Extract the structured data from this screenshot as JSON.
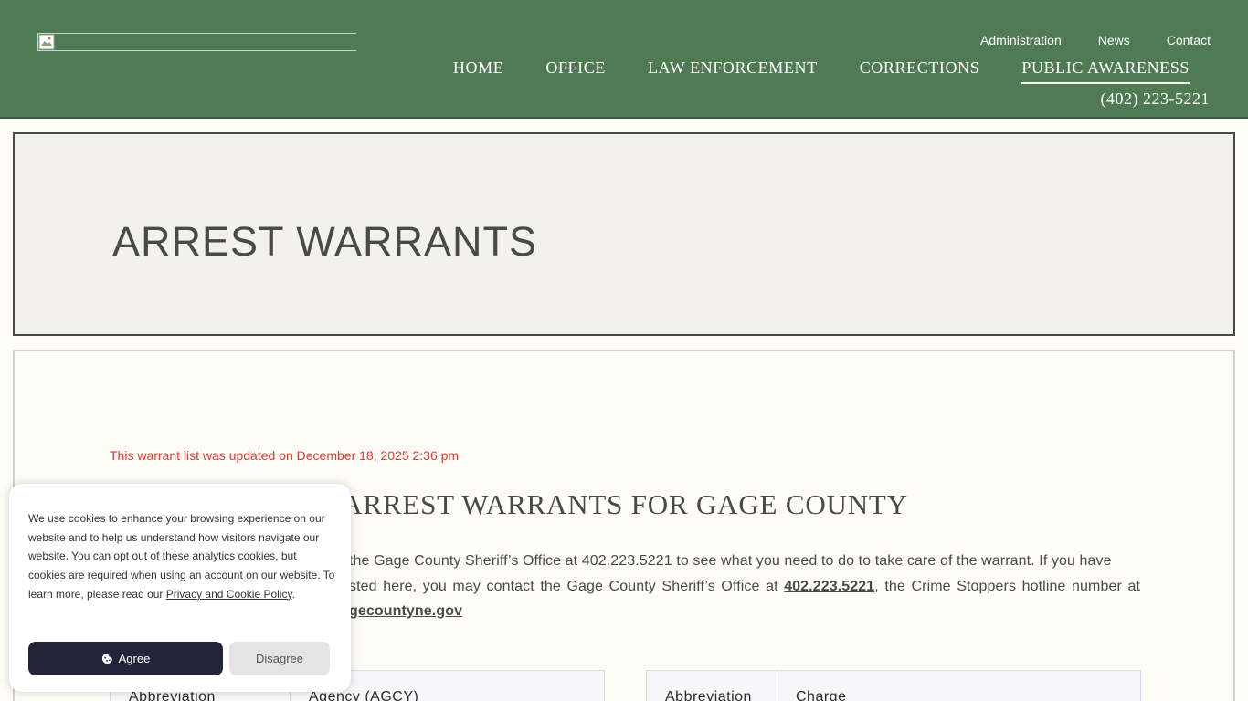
{
  "header": {
    "logo_alt": "",
    "util_nav": [
      "Administration",
      "News",
      "Contact"
    ],
    "main_nav": [
      "HOME",
      "OFFICE",
      "LAW ENFORCEMENT",
      "CORRECTIONS",
      "PUBLIC AWARENESS"
    ],
    "active_nav": "PUBLIC AWARENESS",
    "phone": "(402) 223-5221",
    "bg_color": "#507a53"
  },
  "hero": {
    "title": "ARREST WARRANTS"
  },
  "content": {
    "updated_notice": "This warrant list was updated on December 18, 2025 2:36 pm",
    "section_title": "ARREST WARRANTS FOR GAGE COUNTY",
    "intro_part1": "the Gage County Sheriff’s Office at 402.223.5221 to see what you need to do to take care of the warrant. If you have",
    "intro_part2": "sted here, you may contact the Gage County Sheriff’s Office at ",
    "intro_phone": "402.223.5221",
    "intro_part3": ", the Crime Stoppers hotline number at",
    "intro_email_fragment": "gecountyne.gov"
  },
  "tables": {
    "agency": {
      "col1": "Abbreviation",
      "col2": "Agency (AGCY)"
    },
    "charge": {
      "col1": "Abbreviation",
      "col2": "Charge"
    }
  },
  "cookie": {
    "text": "We use cookies to enhance your browsing experience on our website and to help us understand how visitors navigate our website. You can opt out of these analytics cookies, but cookies are required when using an account on our website. To learn more, please read our ",
    "link": "Privacy and Cookie Policy",
    "text_end": ".",
    "agree": "Agree",
    "disagree": "Disagree"
  }
}
